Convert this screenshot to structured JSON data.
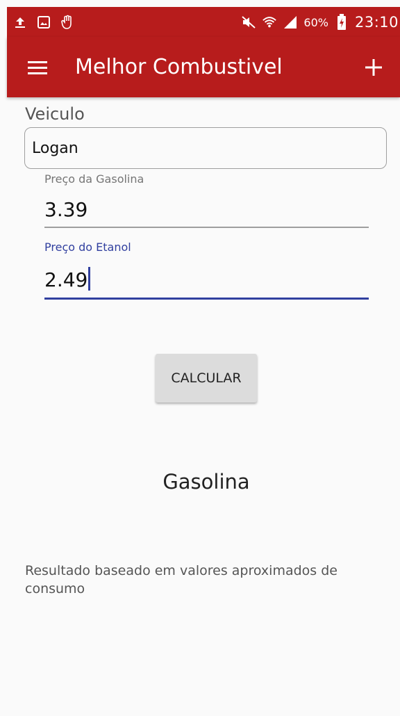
{
  "status_bar": {
    "battery_percent": "60%",
    "time": "23:10",
    "icons": [
      "upload-icon",
      "image-icon",
      "hand-icon",
      "mute-icon",
      "wifi-icon",
      "signal-icon",
      "battery-charging-icon"
    ]
  },
  "app_bar": {
    "title": "Melhor Combustivel",
    "color": "#b71c1c"
  },
  "form": {
    "veiculo_label": "Veiculo",
    "veiculo_value": "Logan",
    "gasolina_label": "Preço da Gasolina",
    "gasolina_value": "3.39",
    "etanol_label": "Preço do Etanol",
    "etanol_value": "2.49",
    "accent_color": "#303f9f"
  },
  "actions": {
    "calcular_label": "CALCULAR"
  },
  "result": {
    "text": "Gasolina",
    "footnote": "Resultado baseado em valores aproximados de consumo"
  }
}
